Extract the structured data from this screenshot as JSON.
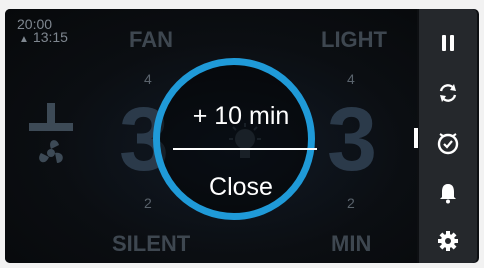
{
  "status": {
    "time_primary": "20:00",
    "time_alarm": "13:15"
  },
  "fan": {
    "label": "FAN",
    "value": "3",
    "upper": "4",
    "lower": "2",
    "mode_label": "SILENT"
  },
  "light": {
    "label": "LIGHT",
    "value": "3",
    "upper": "4",
    "lower": "2",
    "mode_label": "MIN"
  },
  "timer_popup": {
    "add_label": "+ 10 min",
    "close_label": "Close",
    "accent": "#1f9ad8"
  },
  "sidebar": {
    "items": [
      "pause-icon",
      "sync-icon",
      "timer-icon",
      "bell-icon",
      "gear-icon"
    ],
    "selected": "timer-icon"
  }
}
